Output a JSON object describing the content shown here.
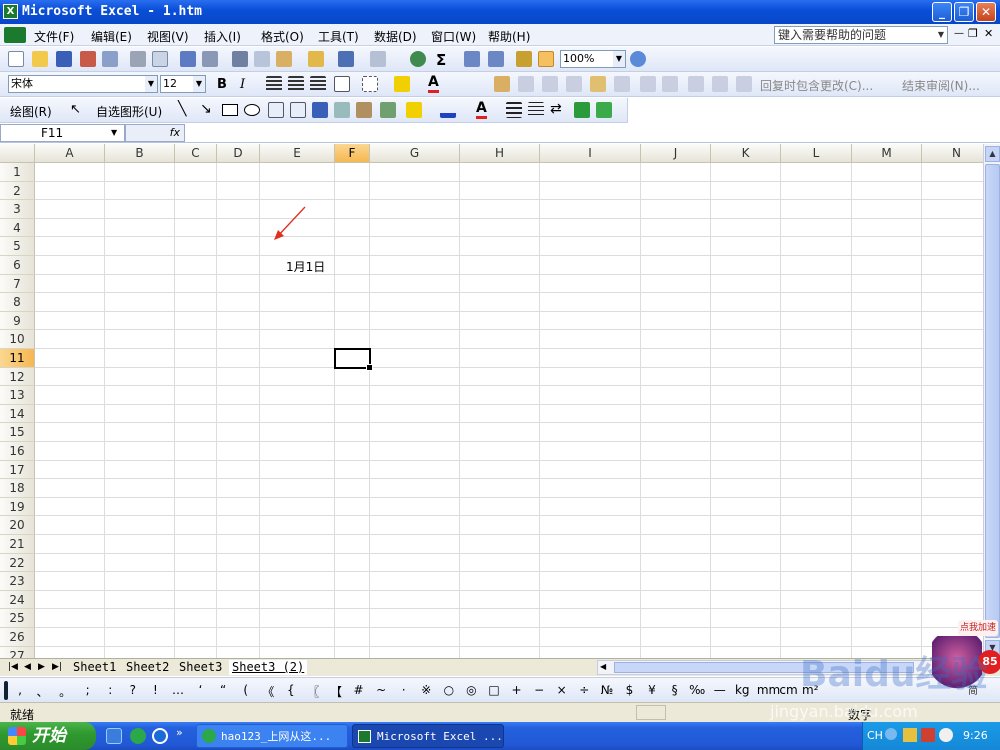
{
  "window": {
    "title": "Microsoft Excel - 1.htm"
  },
  "menu": [
    "文件(F)",
    "编辑(E)",
    "视图(V)",
    "插入(I)",
    "格式(O)",
    "工具(T)",
    "数据(D)",
    "窗口(W)",
    "帮助(H)"
  ],
  "help_box": {
    "placeholder": "键入需要帮助的问题"
  },
  "toolbar": {
    "zoom": "100%",
    "font_name": "宋体",
    "font_size": "12",
    "bold": "B",
    "italic": "I",
    "review_reply": "回复时包含更改(C)...",
    "review_end": "结束审阅(N)..."
  },
  "drawing": {
    "draw_label": "绘图(R)",
    "autoshapes_label": "自选图形(U)"
  },
  "formula_bar": {
    "name_box": "F11",
    "fx": "fx",
    "value": ""
  },
  "grid": {
    "columns": [
      "A",
      "B",
      "C",
      "D",
      "E",
      "F",
      "G",
      "H",
      "I",
      "J",
      "K",
      "L",
      "M",
      "N"
    ],
    "rows": [
      "1",
      "2",
      "3",
      "4",
      "5",
      "6",
      "7",
      "8",
      "9",
      "10",
      "11",
      "12",
      "13",
      "14",
      "15",
      "16",
      "17",
      "18",
      "19",
      "20",
      "21",
      "22",
      "23",
      "24",
      "25",
      "26",
      "27"
    ],
    "active_cell": "F11",
    "cell_e6": "1月1日"
  },
  "sheets": [
    "Sheet1",
    "Sheet2",
    "Sheet3",
    "Sheet3 (2)"
  ],
  "symbols": [
    ",",
    "、",
    "。",
    ";",
    ":",
    "?",
    "!",
    "…",
    "‘",
    "“",
    "(",
    "《",
    "{",
    "〖",
    "【",
    "#",
    "~",
    "·",
    "※",
    "○",
    "◎",
    "□",
    "+",
    "−",
    "×",
    "÷",
    "№",
    "$",
    "¥",
    "§",
    "‰",
    "—",
    "kg",
    "mm",
    "cm",
    "m²"
  ],
  "status": {
    "ready": "就绪",
    "num": "数字"
  },
  "taskbar": {
    "start": "开始",
    "items": [
      "hao123_上网从这...",
      "Microsoft Excel ..."
    ],
    "tray_lang": "CH",
    "clock": "9:26"
  },
  "watermark": {
    "text": "Baidu经验",
    "url": "jingyan.baidu.com",
    "badge": "点我加速",
    "badge2": "简",
    "badge_num": "85"
  },
  "colors": {
    "title_blue": "#0a4fd8",
    "selected_header": "#f6b752",
    "arrow_red": "#e03020",
    "start_green": "#2f9a2f"
  }
}
